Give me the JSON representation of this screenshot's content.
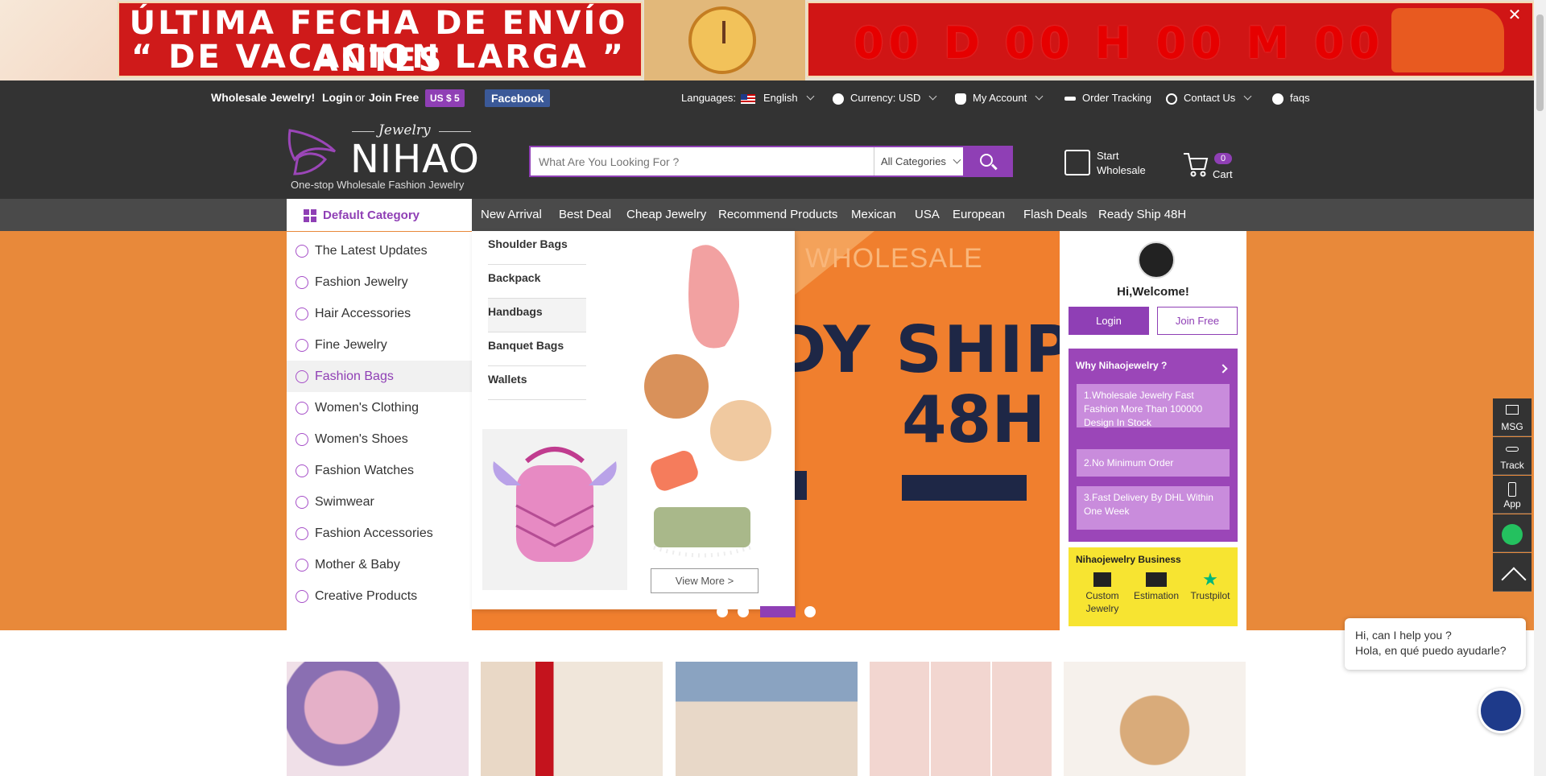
{
  "banner": {
    "title_line1": "ÚLTIMA FECHA DE ENVÍO ANTES",
    "title_line2": "“ DE VACACION LARGA ”",
    "countdown": "00 D 00 H 00 M 00 S",
    "close": "✕"
  },
  "topbar": {
    "wholesale": "Wholesale Jewelry!",
    "login": "Login",
    "or": "or",
    "join": "Join Free",
    "coupon": "US $ 5",
    "facebook": "Facebook",
    "languages_label": "Languages:",
    "language": "English",
    "currency": "Currency: USD",
    "account": "My Account",
    "order_tracking": "Order Tracking",
    "contact": "Contact Us",
    "faqs": "faqs"
  },
  "header": {
    "logo_script": "Jewelry",
    "logo_name": "NIHAO",
    "tagline": "One-stop Wholesale Fashion Jewelry",
    "search_placeholder": "What Are You Looking For ?",
    "category_select": "All Categories",
    "start_wholesale_1": "Start",
    "start_wholesale_2": "Wholesale",
    "cart_count": "0",
    "cart_label": "Cart"
  },
  "nav": {
    "default_category": "Default Category",
    "items": [
      "New Arrival",
      "Best Deal",
      "Cheap Jewelry",
      "Recommend Products",
      "Mexican",
      "USA",
      "European",
      "Flash Deals",
      "Ready Ship 48H"
    ]
  },
  "categories": [
    "The Latest Updates",
    "Fashion Jewelry",
    "Hair Accessories",
    "Fine Jewelry",
    "Fashion Bags",
    "Women's Clothing",
    "Women's Shoes",
    "Fashion Watches",
    "Swimwear",
    "Fashion Accessories",
    "Mother & Baby",
    "Creative Products"
  ],
  "active_category": "Fashion Bags",
  "flyout": {
    "links": [
      "Shoulder Bags",
      "Backpack",
      "Handbags",
      "Banquet Bags",
      "Wallets"
    ],
    "view_more": "View More >"
  },
  "hero": {
    "watermark": "WHOLESALE",
    "line1": "DY SHIP",
    "line2": "48H"
  },
  "carousel": {
    "slides": 4,
    "active": 3
  },
  "right_panel": {
    "welcome": "Hi,Welcome!",
    "login": "Login",
    "join": "Join Free",
    "why_title": "Why Nihaojewelry",
    "why_items": [
      "1.Wholesale Jewelry Fast Fashion More Than 100000 Design In Stock",
      "2.No Minimum Order",
      "3.Fast Delivery By DHL Within One Week"
    ],
    "business_title": "Nihaojewelry Business",
    "business_items": [
      "Custom Jewelry",
      "Estimation",
      "Trustpilot"
    ]
  },
  "side_tools": [
    "MSG",
    "Track",
    "App"
  ],
  "chat": {
    "line1": "Hi, can I help you ?",
    "line2": "Hola, en qué puedo ayudarle?"
  },
  "colors": {
    "brand_purple": "#8f3fb5",
    "dark_bar": "#333333",
    "hero_orange": "#e8893a",
    "banner_red": "#d01515",
    "business_yellow": "#f7e431"
  }
}
